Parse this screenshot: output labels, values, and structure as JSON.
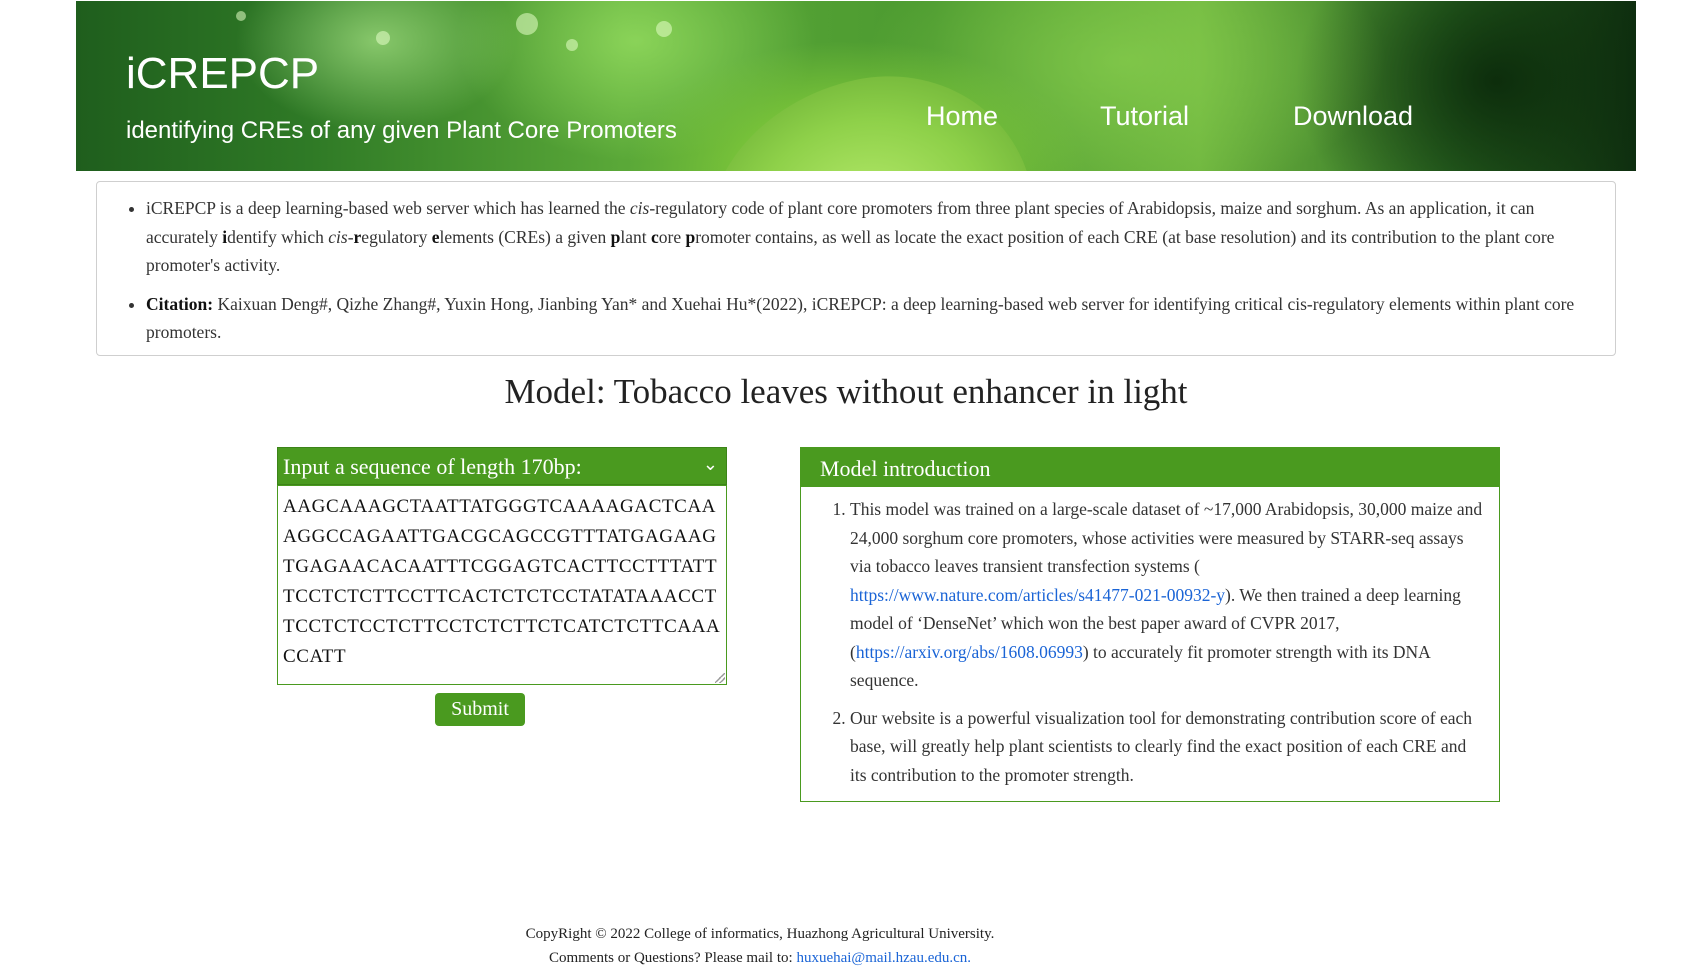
{
  "header": {
    "title": "iCREPCP",
    "subtitle": "identifying CREs of any given Plant Core Promoters",
    "nav": [
      {
        "label": "Home"
      },
      {
        "label": "Tutorial"
      },
      {
        "label": "Download"
      }
    ]
  },
  "intro": {
    "p1_a": "iCREPCP is a deep learning-based web server which has learned the ",
    "p1_cis1": "cis",
    "p1_b": "-regulatory code of plant core promoters from three plant species of Arabidopsis, maize and sorghum. As an application, it can accurately ",
    "p1_i": "i",
    "p1_c": "dentify which ",
    "p1_cis2": "cis",
    "p1_dash": "-",
    "p1_r": "r",
    "p1_d": "egulatory ",
    "p1_e": "e",
    "p1_f": "lements (CREs) a given ",
    "p1_p": "p",
    "p1_g": "lant ",
    "p1_c2": "c",
    "p1_h": "ore ",
    "p1_p2": "p",
    "p1_j": "romoter contains, as well as locate the exact position of each CRE (at base resolution) and its contribution to the plant core promoter's activity.",
    "citation_label": "Citation:",
    "citation_text": " Kaixuan Deng#, Qizhe Zhang#, Yuxin Hong, Jianbing Yan* and Xuehai Hu*(2022), iCREPCP: a deep learning-based web server for identifying critical cis-regulatory elements within plant core promoters."
  },
  "model_title": "Model: Tobacco leaves without enhancer in light",
  "input": {
    "select_label": "Input a sequence of length 170bp:",
    "sequence": "AAGCAAAGCTAATTATGGGTCAAAAGACTCAAAGGCCAGAATTGACGCAGCCGTTTATGAGAAGTGAGAACACAATTTCGGAGTCACTTCCTTTATTTCCTCTCTTCCTTCACTCTCTCCTATATAAACCTTCCTCTCCTCTTCCTCTCTTCTCATCTCTTCAAACCATT",
    "submit_label": "Submit"
  },
  "model_intro": {
    "heading": "Model introduction",
    "item1_a": "This model was trained on a large-scale dataset of ~17,000 Arabidopsis, 30,000 maize and 24,000 sorghum core promoters, whose activities were measured by STARR-seq assays via tobacco leaves transient transfection systems ( ",
    "item1_link1": "https://www.nature.com/articles/s41477-021-00932-y",
    "item1_b": "). We then trained a deep learning model of ‘DenseNet’ which won the best paper award of CVPR 2017, (",
    "item1_link2": "https://arxiv.org/abs/1608.06993",
    "item1_c": ") to accurately fit promoter strength with its DNA sequence.",
    "item2": "Our website is a powerful visualization tool for demonstrating contribution score of each base, will greatly help plant scientists to clearly find the exact position of each CRE and its contribution to the promoter strength."
  },
  "footer": {
    "copyright": "CopyRight © 2022 College of informatics, Huazhong Agricultural University.",
    "contact_prefix": "Comments or Questions? Please mail to: ",
    "email": "huxuehai@mail.hzau.edu.cn."
  }
}
